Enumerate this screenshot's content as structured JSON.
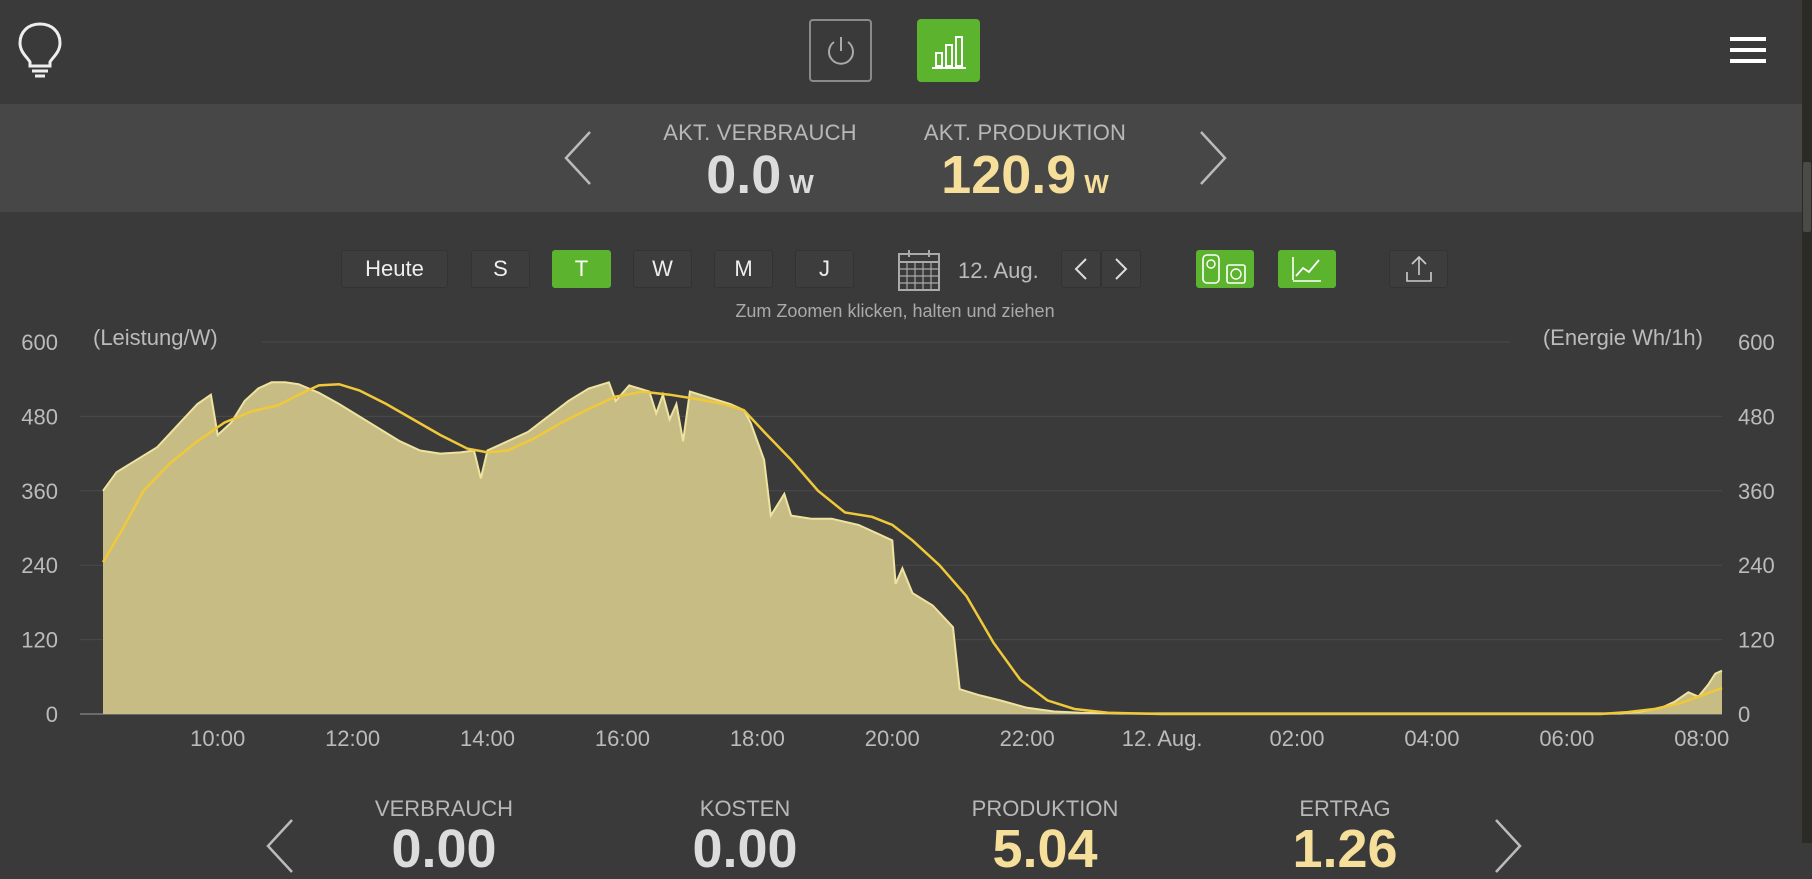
{
  "header": {
    "logo_icon": "lightbulb-icon",
    "power_icon": "power-icon",
    "stats_icon": "bar-chart-icon",
    "menu_icon": "hamburger-menu-icon",
    "accent": "#5cb32e"
  },
  "live": {
    "consumption_label": "AKT. VERBRAUCH",
    "consumption_value": "0.0",
    "consumption_unit": "W",
    "production_label": "AKT. PRODUKTION",
    "production_value": "120.9",
    "production_unit": "W"
  },
  "controls": {
    "today": "Heute",
    "periods": [
      "S",
      "T",
      "W",
      "M",
      "J"
    ],
    "active_period": "T",
    "date": "12. Aug.",
    "zoom_hint": "Zum Zoomen klicken, halten und ziehen"
  },
  "chart_data": {
    "type": "area",
    "ylabel_left": "(Leistung/W)",
    "ylabel_right": "(Energie Wh/1h)",
    "ylim": [
      0,
      600
    ],
    "yticks": [
      "0",
      "120",
      "240",
      "360",
      "480",
      "600"
    ],
    "xlim_hours": [
      8.3,
      32.3
    ],
    "xticks": [
      {
        "h": 10,
        "label": "10:00"
      },
      {
        "h": 12,
        "label": "12:00"
      },
      {
        "h": 14,
        "label": "14:00"
      },
      {
        "h": 16,
        "label": "16:00"
      },
      {
        "h": 18,
        "label": "18:00"
      },
      {
        "h": 20,
        "label": "20:00"
      },
      {
        "h": 22,
        "label": "22:00"
      },
      {
        "h": 24,
        "label": "12. Aug."
      },
      {
        "h": 26,
        "label": "02:00"
      },
      {
        "h": 28,
        "label": "04:00"
      },
      {
        "h": 30,
        "label": "06:00"
      },
      {
        "h": 32,
        "label": "08:00"
      }
    ],
    "grid": true,
    "colors": {
      "area": "#c7bc84",
      "area_edge": "#efe3a0",
      "line": "#f0c93a"
    },
    "series": [
      {
        "kind": "area",
        "points": [
          [
            8.3,
            360
          ],
          [
            8.5,
            390
          ],
          [
            8.8,
            410
          ],
          [
            9.1,
            430
          ],
          [
            9.4,
            465
          ],
          [
            9.7,
            500
          ],
          [
            9.9,
            515
          ],
          [
            10.0,
            450
          ],
          [
            10.2,
            470
          ],
          [
            10.4,
            505
          ],
          [
            10.6,
            525
          ],
          [
            10.8,
            535
          ],
          [
            11.0,
            535
          ],
          [
            11.2,
            532
          ],
          [
            11.5,
            518
          ],
          [
            11.8,
            500
          ],
          [
            12.1,
            480
          ],
          [
            12.4,
            460
          ],
          [
            12.7,
            440
          ],
          [
            13.0,
            425
          ],
          [
            13.3,
            420
          ],
          [
            13.6,
            422
          ],
          [
            13.8,
            425
          ],
          [
            13.9,
            380
          ],
          [
            14.0,
            425
          ],
          [
            14.3,
            440
          ],
          [
            14.6,
            455
          ],
          [
            14.9,
            480
          ],
          [
            15.2,
            505
          ],
          [
            15.5,
            525
          ],
          [
            15.8,
            535
          ],
          [
            15.9,
            505
          ],
          [
            16.1,
            530
          ],
          [
            16.4,
            520
          ],
          [
            16.5,
            485
          ],
          [
            16.6,
            515
          ],
          [
            16.7,
            475
          ],
          [
            16.8,
            500
          ],
          [
            16.9,
            440
          ],
          [
            17.0,
            520
          ],
          [
            17.3,
            510
          ],
          [
            17.6,
            500
          ],
          [
            17.8,
            490
          ],
          [
            17.9,
            470
          ],
          [
            18.1,
            410
          ],
          [
            18.2,
            320
          ],
          [
            18.4,
            355
          ],
          [
            18.5,
            320
          ],
          [
            18.8,
            315
          ],
          [
            19.1,
            315
          ],
          [
            19.5,
            305
          ],
          [
            19.8,
            290
          ],
          [
            20.0,
            280
          ],
          [
            20.05,
            210
          ],
          [
            20.15,
            235
          ],
          [
            20.3,
            195
          ],
          [
            20.6,
            175
          ],
          [
            20.9,
            140
          ],
          [
            21.0,
            40
          ],
          [
            21.3,
            30
          ],
          [
            21.6,
            22
          ],
          [
            22.0,
            10
          ],
          [
            22.4,
            4
          ],
          [
            22.8,
            2
          ],
          [
            23.5,
            1
          ],
          [
            25,
            1
          ],
          [
            27,
            1
          ],
          [
            29,
            1
          ],
          [
            30.8,
            1
          ],
          [
            31.1,
            4
          ],
          [
            31.4,
            10
          ],
          [
            31.6,
            20
          ],
          [
            31.8,
            35
          ],
          [
            31.95,
            28
          ],
          [
            32.1,
            48
          ],
          [
            32.2,
            65
          ],
          [
            32.3,
            70
          ]
        ]
      },
      {
        "kind": "line",
        "points": [
          [
            8.3,
            245
          ],
          [
            8.6,
            300
          ],
          [
            8.9,
            360
          ],
          [
            9.3,
            405
          ],
          [
            9.7,
            440
          ],
          [
            10.1,
            470
          ],
          [
            10.5,
            488
          ],
          [
            10.9,
            498
          ],
          [
            11.2,
            515
          ],
          [
            11.5,
            530
          ],
          [
            11.8,
            532
          ],
          [
            12.1,
            522
          ],
          [
            12.5,
            500
          ],
          [
            12.9,
            475
          ],
          [
            13.3,
            450
          ],
          [
            13.7,
            428
          ],
          [
            14.0,
            422
          ],
          [
            14.3,
            425
          ],
          [
            14.7,
            445
          ],
          [
            15.1,
            470
          ],
          [
            15.5,
            492
          ],
          [
            15.9,
            512
          ],
          [
            16.3,
            520
          ],
          [
            16.7,
            515
          ],
          [
            17.1,
            508
          ],
          [
            17.5,
            500
          ],
          [
            17.8,
            490
          ],
          [
            18.1,
            455
          ],
          [
            18.5,
            410
          ],
          [
            18.9,
            360
          ],
          [
            19.3,
            325
          ],
          [
            19.7,
            318
          ],
          [
            20.0,
            305
          ],
          [
            20.3,
            280
          ],
          [
            20.7,
            240
          ],
          [
            21.1,
            190
          ],
          [
            21.5,
            115
          ],
          [
            21.9,
            55
          ],
          [
            22.3,
            22
          ],
          [
            22.7,
            8
          ],
          [
            23.2,
            2
          ],
          [
            24,
            0
          ],
          [
            26,
            0
          ],
          [
            28,
            0
          ],
          [
            30.5,
            0
          ],
          [
            30.9,
            3
          ],
          [
            31.3,
            8
          ],
          [
            31.7,
            18
          ],
          [
            32.0,
            30
          ],
          [
            32.3,
            42
          ]
        ]
      }
    ]
  },
  "summary": {
    "items": [
      {
        "label": "VERBRAUCH",
        "value": "0.00",
        "color": "#dcdcdc"
      },
      {
        "label": "KOSTEN",
        "value": "0.00",
        "color": "#dcdcdc"
      },
      {
        "label": "PRODUKTION",
        "value": "5.04",
        "color": "#f5df9a"
      },
      {
        "label": "ERTRAG",
        "value": "1.26",
        "color": "#f5df9a"
      }
    ]
  }
}
